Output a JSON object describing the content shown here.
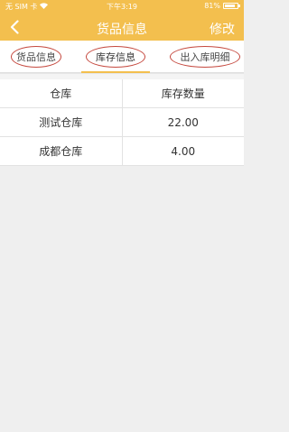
{
  "status_bar": {
    "carrier": "无 SIM 卡",
    "time": "下午3:19",
    "battery": "81%"
  },
  "header": {
    "title": "货品信息",
    "edit_label": "修改"
  },
  "tabs": [
    {
      "label": "货品信息"
    },
    {
      "label": "库存信息"
    },
    {
      "label": "出入库明细"
    }
  ],
  "table": {
    "columns": [
      "仓库",
      "库存数量"
    ],
    "rows": [
      {
        "warehouse": "测试仓库",
        "quantity": "22.00"
      },
      {
        "warehouse": "成都仓库",
        "quantity": "4.00"
      }
    ]
  },
  "colors": {
    "accent": "#f3bf4e",
    "ring": "#c5483e",
    "background": "#efefef"
  }
}
